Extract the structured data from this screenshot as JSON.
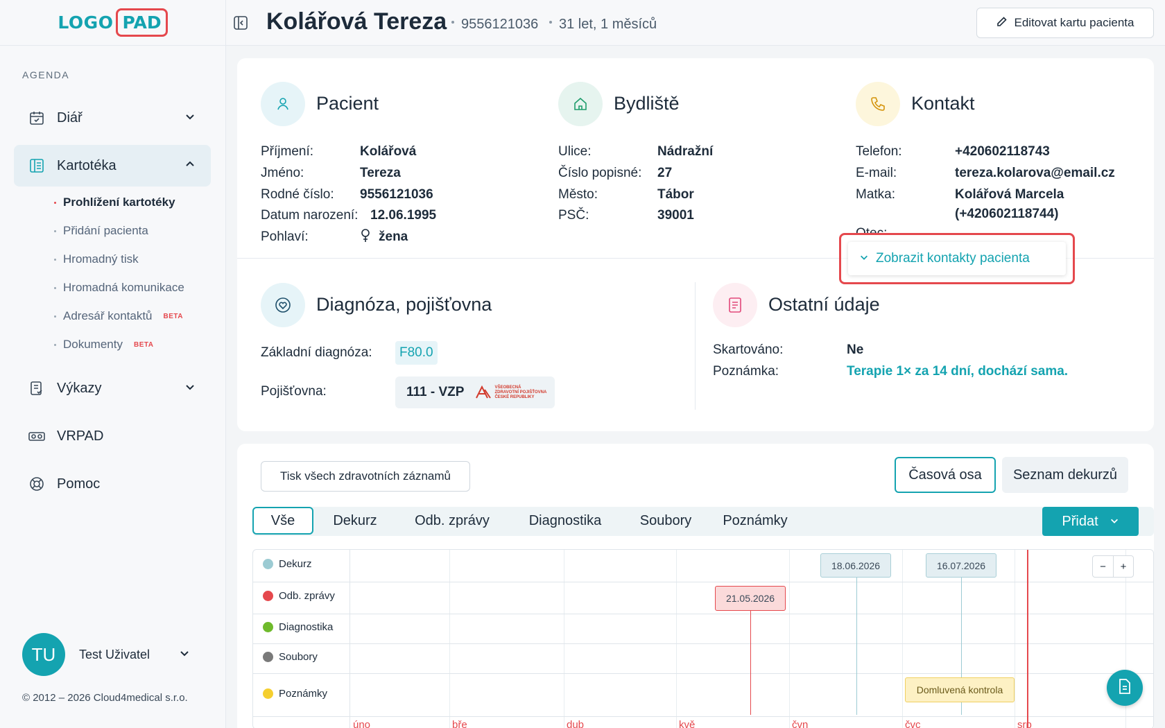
{
  "logo": {
    "part1": "LOGO",
    "part2": "PAD"
  },
  "sidebar": {
    "section_label": "AGENDA",
    "items": [
      {
        "label": "Diář",
        "icon": "calendar-icon"
      },
      {
        "label": "Kartotéka",
        "icon": "card-file-icon"
      },
      {
        "label": "Výkazy",
        "icon": "report-icon"
      },
      {
        "label": "VRPAD",
        "icon": "vr-headset-icon"
      },
      {
        "label": "Pomoc",
        "icon": "lifebuoy-icon"
      }
    ],
    "subitems": [
      {
        "label": "Prohlížení kartotéky"
      },
      {
        "label": "Přidání pacienta"
      },
      {
        "label": "Hromadný tisk"
      },
      {
        "label": "Hromadná komunikace"
      },
      {
        "label": "Adresář kontaktů",
        "badge": "BETA"
      },
      {
        "label": "Dokumenty",
        "badge": "BETA"
      }
    ],
    "user": {
      "initials": "TU",
      "name": "Test Uživatel"
    },
    "copyright": "© 2012 – 2026 Cloud4medical s.r.o."
  },
  "header": {
    "patient_name": "Kolářová Tereza",
    "birth_number": "9556121036",
    "age": "31 let, 1 měsíců",
    "edit_label": "Editovat kartu pacienta"
  },
  "patient": {
    "title": "Pacient",
    "rows": [
      {
        "label": "Příjmení:",
        "value": "Kolářová"
      },
      {
        "label": "Jméno:",
        "value": "Tereza"
      },
      {
        "label": "Rodné číslo:",
        "value": "9556121036"
      },
      {
        "label": "Datum narození:",
        "value": "12.06.1995"
      },
      {
        "label": "Pohlaví:",
        "value": "žena"
      }
    ]
  },
  "address": {
    "title": "Bydliště",
    "rows": [
      {
        "label": "Ulice:",
        "value": "Nádražní"
      },
      {
        "label": "Číslo popisné:",
        "value": "27"
      },
      {
        "label": "Město:",
        "value": "Tábor"
      },
      {
        "label": "PSČ:",
        "value": "39001"
      }
    ]
  },
  "contact": {
    "title": "Kontakt",
    "rows": [
      {
        "label": "Telefon:",
        "value": "+420602118743"
      },
      {
        "label": "E-mail:",
        "value": "tereza.kolarova@email.cz"
      },
      {
        "label": "Matka:",
        "value": "Kolářová Marcela",
        "value2": "(+420602118744)"
      }
    ],
    "father_label_peek": "Otec:",
    "show_contacts_label": "Zobrazit kontakty pacienta"
  },
  "diagnosis": {
    "title": "Diagnóza, pojišťovna",
    "dx_label": "Základní diagnóza:",
    "dx_value": "F80.0",
    "ins_label": "Pojišťovna:",
    "ins_value": "111 - VZP",
    "ins_logo_text": [
      "VŠEOBECNÁ",
      "ZDRAVOTNÍ POJIŠŤOVNA",
      "ČESKÉ REPUBLIKY"
    ]
  },
  "other": {
    "title": "Ostatní údaje",
    "rows": [
      {
        "label": "Skartováno:",
        "value": "Ne"
      },
      {
        "label": "Poznámka:",
        "value": "Terapie 1× za 14 dní, dochází sama."
      }
    ]
  },
  "records": {
    "print_all_label": "Tisk všech zdravotních záznamů",
    "views": [
      {
        "label": "Časová osa",
        "active": true
      },
      {
        "label": "Seznam dekurzů",
        "active": false
      }
    ],
    "tabs": [
      "Vše",
      "Dekurz",
      "Odb. zprávy",
      "Diagnostika",
      "Soubory",
      "Poznámky"
    ],
    "add_label": "Přidat",
    "timeline": {
      "rows": [
        {
          "label": "Dekurz",
          "color": "#9ccbd3"
        },
        {
          "label": "Odb. zprávy",
          "color": "#e5484d"
        },
        {
          "label": "Diagnostika",
          "color": "#6fba2c"
        },
        {
          "label": "Soubory",
          "color": "#7a7a7a"
        },
        {
          "label": "Poznámky",
          "color": "#f5cf2f"
        }
      ],
      "events": [
        {
          "row": "Dekurz",
          "date": "18.06.2026"
        },
        {
          "row": "Dekurz",
          "date": "16.07.2026"
        },
        {
          "row": "Odb. zprávy",
          "date": "21.05.2026"
        },
        {
          "row": "Poznámky",
          "text": "Domluvená kontrola"
        }
      ],
      "zoom_out": "−",
      "zoom_in": "+",
      "months": [
        "úno",
        "bře",
        "dub",
        "kvě",
        "čvn",
        "čvc",
        "srp"
      ]
    }
  }
}
